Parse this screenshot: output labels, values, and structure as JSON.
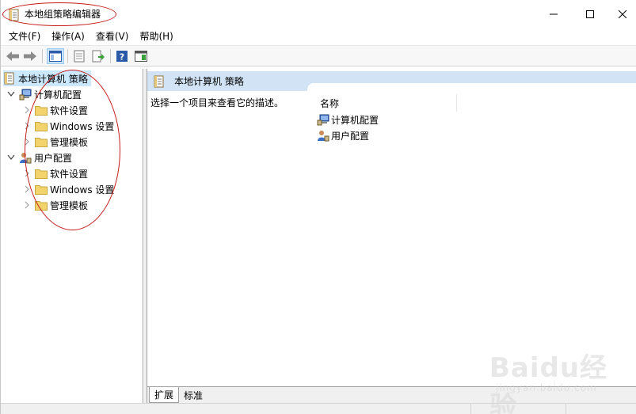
{
  "window": {
    "title": "本地组策略编辑器"
  },
  "menu": {
    "items": [
      "文件(F)",
      "操作(A)",
      "查看(V)",
      "帮助(H)"
    ]
  },
  "toolbar": {
    "icons": [
      "back-arrow-icon",
      "forward-arrow-icon",
      "show-hide-tree-icon",
      "properties-icon",
      "export-list-icon",
      "help-icon",
      "show-hide-action-pane-icon"
    ]
  },
  "tree": {
    "root": "本地计算机 策略",
    "computer_config": "计算机配置",
    "computer_children": [
      "软件设置",
      "Windows 设置",
      "管理模板"
    ],
    "user_config": "用户配置",
    "user_children": [
      "软件设置",
      "Windows 设置",
      "管理模板"
    ]
  },
  "right_pane": {
    "header": "本地计算机 策略",
    "description": "选择一个项目来查看它的描述。",
    "column_name": "名称",
    "items": [
      "计算机配置",
      "用户配置"
    ]
  },
  "tabs": {
    "extended": "扩展",
    "standard": "标准"
  },
  "watermark": {
    "main": "Baidu经验",
    "sub": "jingyan.baidu.com"
  },
  "colors": {
    "selection": "#cce8ff",
    "header_band": "#d1e3f4",
    "annotation_red": "#c61a1a",
    "folder_yellow": "#f3d36b"
  }
}
